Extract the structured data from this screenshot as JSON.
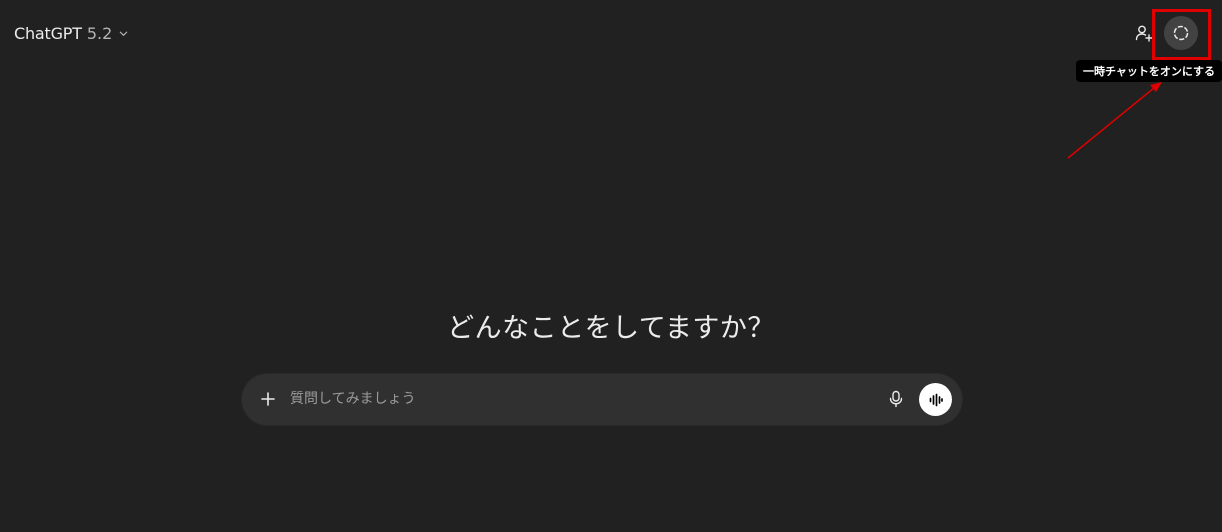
{
  "header": {
    "model_name": "ChatGPT",
    "model_version": "5.2",
    "invite_icon": "add-person-icon",
    "temporary_chat_icon": "dashed-circle-icon",
    "temporary_chat_tooltip": "一時チャットをオンにする"
  },
  "main": {
    "heading": "どんなことをしてますか？"
  },
  "composer": {
    "placeholder": "質問してみましょう",
    "value": "",
    "plus_icon": "plus-icon",
    "mic_icon": "microphone-icon",
    "voice_icon": "voice-waveform-icon"
  },
  "colors": {
    "background": "#212121",
    "composer_bg": "#303030",
    "annotation_red": "#e00000",
    "tooltip_bg": "#000000"
  }
}
